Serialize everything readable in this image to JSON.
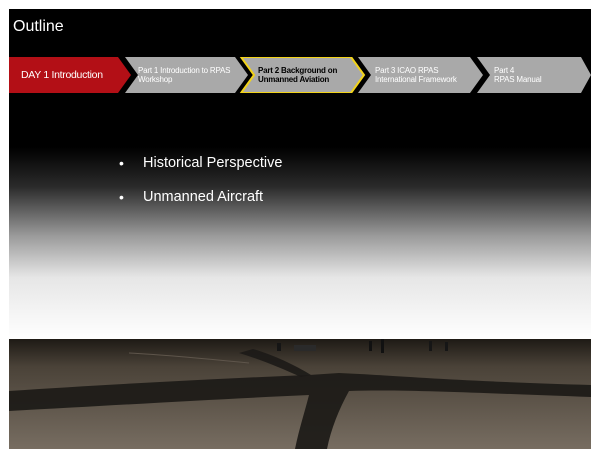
{
  "title": "Outline",
  "nav": {
    "items": [
      {
        "label_1": "DAY 1 Introduction",
        "label_2": "",
        "color": "#b30f16",
        "state": "day"
      },
      {
        "label_1": "Part 1 Introduction to RPAS",
        "label_2": "Workshop",
        "color": "#a9a9a9",
        "state": "normal"
      },
      {
        "label_1": "Part 2 Background on",
        "label_2": "Unmanned Aviation",
        "color": "#a9a9a9",
        "state": "active"
      },
      {
        "label_1": "Part 3 ICAO RPAS",
        "label_2": "International Framework",
        "color": "#a9a9a9",
        "state": "normal"
      },
      {
        "label_1": "Part 4",
        "label_2": "RPAS Manual",
        "color": "#a9a9a9",
        "state": "normal"
      }
    ],
    "active_outline_color": "#f2d31a"
  },
  "bullets": [
    "Historical Perspective",
    "Unmanned Aircraft"
  ]
}
